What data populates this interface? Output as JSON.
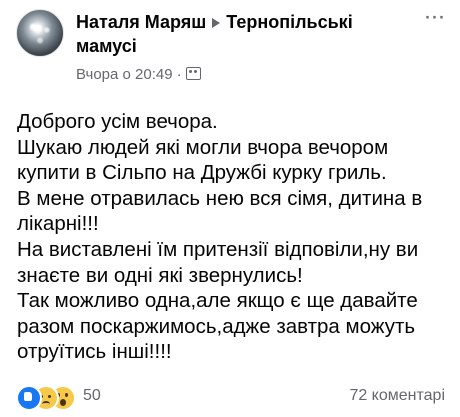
{
  "post": {
    "author": "Наталя Маряш",
    "group_line1": "Тернопільські",
    "group_line2": "мамусі",
    "timestamp": "Вчора о 20:49",
    "meta_separator": "·",
    "privacy_icon": "friends-icon",
    "more_label": "···",
    "text_lines": [
      "Доброго усім вечора.",
      "Шукаю людей які могли вчора вечором",
      "купити в Сільпо на Дружбі курку гриль.",
      "В мене отравилась нею вся сімя, дитина в",
      "лікарні!!!",
      "На виставлені їм притензії відповіли,ну ви",
      "знаєте ви одні які звернулись!",
      "Так можливо одна,але якщо є ще давайте",
      "разом поскаржимось,адже завтра можуть",
      "отруїтись інші!!!!"
    ]
  },
  "footer": {
    "reactions": [
      "like-icon",
      "sad-icon",
      "wow-icon"
    ],
    "reaction_count": "50",
    "comments": "72 коментарі"
  },
  "colors": {
    "text": "#050505",
    "secondary": "#65676b",
    "like_blue": "#1877f2",
    "emoji_yellow": "#f7c94a"
  }
}
